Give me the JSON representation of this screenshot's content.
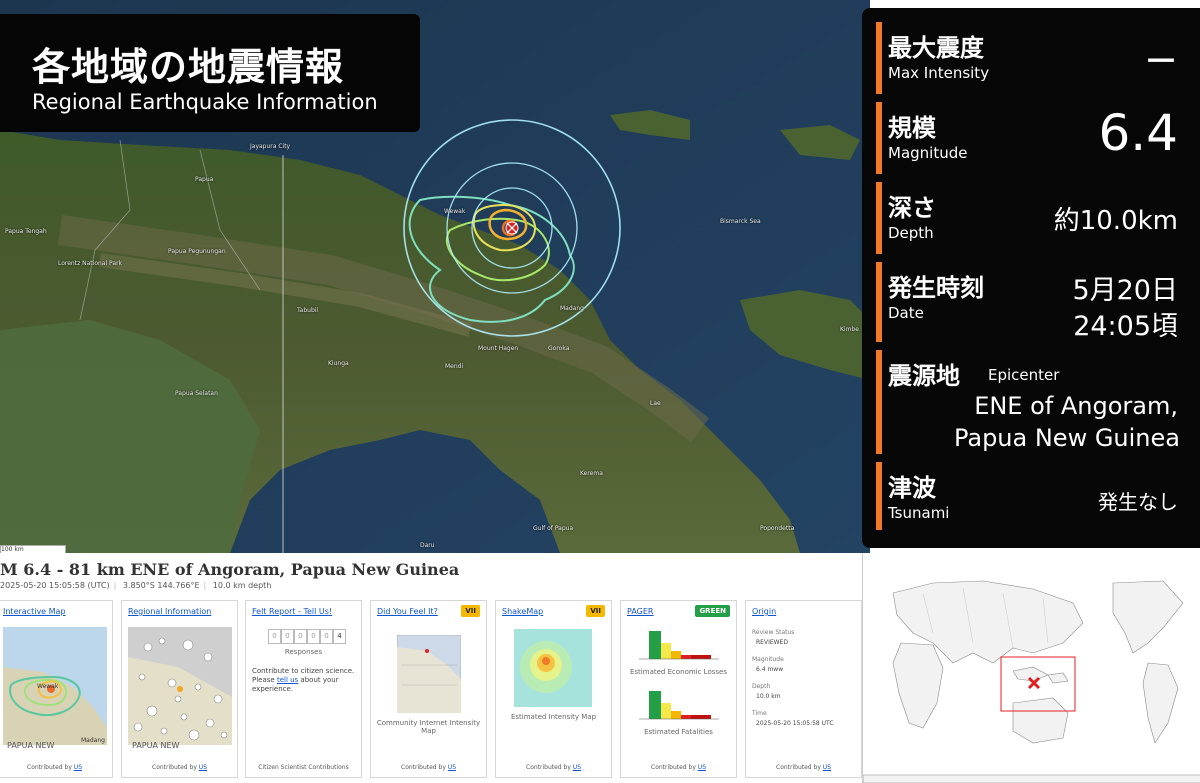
{
  "header": {
    "title_jp": "各地域の地震情報",
    "title_en": "Regional Earthquake Information"
  },
  "info": {
    "max_intensity": {
      "label_jp": "最大震度",
      "label_en": "Max  Intensity",
      "value": "－"
    },
    "magnitude": {
      "label_jp": "規模",
      "label_en": "Magnitude",
      "value": "6.4"
    },
    "depth": {
      "label_jp": "深さ",
      "label_en": "Depth",
      "value": "約10.0km"
    },
    "date": {
      "label_jp": "発生時刻",
      "label_en": "Date",
      "value_line1": "5月20日",
      "value_line2": "24:05頃"
    },
    "epicenter": {
      "label_jp": "震源地",
      "label_en": "Epicenter",
      "value_line1": "ENE of Angoram,",
      "value_line2": "Papua New Guinea"
    },
    "tsunami": {
      "label_jp": "津波",
      "label_en": "Tsunami",
      "value": "発生なし"
    }
  },
  "map": {
    "places": {
      "jayapura": "Jayapura City",
      "papua": "Papua",
      "tengah": "Papua Tengah",
      "pegunungan": "Papua Pegunungan",
      "lorentz": "Lorentz National Park",
      "wewak": "Wewak",
      "bismarck": "Bismarck Sea",
      "madang": "Madang",
      "tabubil": "Tabubil",
      "kiunga": "Kiunga",
      "mount_hagen": "Mount Hagen",
      "goroka": "Goroka",
      "mendi": "Mendi",
      "lae": "Lae",
      "kimbe": "Kimbe",
      "selatan": "Papua Selatan",
      "kerema": "Kerema",
      "daru": "Daru",
      "gulf": "Gulf of Papua",
      "popondetta": "Popondetta"
    },
    "scale_label": "100 km"
  },
  "usgs": {
    "title": "M 6.4 - 81 km ENE of Angoram, Papua New Guinea",
    "time": "2025-05-20 15:05:58 (UTC)",
    "coords": "3.850°S 144.766°E",
    "depth": "10.0 km depth",
    "cards": {
      "interactive": {
        "link": "Interactive Map",
        "map_label1": "Wewak",
        "map_label2": "Madang",
        "map_label3": "PAPUA NEW",
        "foot_prefix": "Contributed by ",
        "foot_link": "US"
      },
      "regional": {
        "link": "Regional Information",
        "map_label": "PAPUA NEW",
        "foot_prefix": "Contributed by ",
        "foot_link": "US"
      },
      "felt": {
        "link": "Felt Report - Tell Us!",
        "counter": [
          "0",
          "0",
          "0",
          "0",
          "0",
          "4"
        ],
        "responses": "Responses",
        "text1": "Contribute to citizen science.",
        "text2_prefix": "Please ",
        "text2_link": "tell us",
        "text2_suffix": " about your",
        "text3": "experience.",
        "foot": "Citizen Scientist Contributions"
      },
      "dyfi": {
        "link": "Did You Feel It?",
        "badge": "VII",
        "caption": "Community Internet Intensity Map",
        "foot_prefix": "Contributed by ",
        "foot_link": "US"
      },
      "shakemap": {
        "link": "ShakeMap",
        "badge": "VII",
        "caption": "Estimated Intensity Map",
        "foot_prefix": "Contributed by ",
        "foot_link": "US"
      },
      "pager": {
        "link": "PAGER",
        "badge": "GREEN",
        "caption1": "Estimated Economic Losses",
        "caption2": "Estimated Fatalities",
        "foot_prefix": "Contributed by ",
        "foot_link": "US"
      },
      "origin": {
        "link": "Origin",
        "status_label": "Review Status",
        "status_value": "REVIEWED",
        "mag_label": "Magnitude",
        "mag_value": "6.4 mww",
        "depth_label": "Depth",
        "depth_value": "10.0 km",
        "time_label": "Time",
        "time_value": "2025-05-20 15:05:58 UTC",
        "foot_prefix": "Contributed by ",
        "foot_link": "US"
      }
    }
  },
  "colors": {
    "panel_bg": "#070707",
    "accent_bar": "#f07a28",
    "badge_vii": "#f5b800",
    "badge_green": "#23a047",
    "link": "#1155cc",
    "epicenter_mark": "#e02020"
  }
}
